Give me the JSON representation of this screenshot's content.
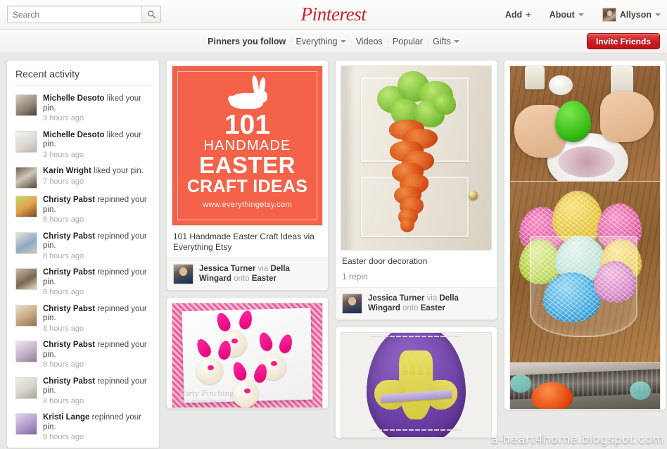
{
  "header": {
    "logo": "Pinterest",
    "search": {
      "placeholder": "Search",
      "value": ""
    },
    "search_icon": "search-icon",
    "add": {
      "label": "Add",
      "plus": "+"
    },
    "about": {
      "label": "About"
    },
    "user": {
      "label": "Allyson"
    }
  },
  "subnav": {
    "pinners_you_follow": "Pinners you follow",
    "sep": "·",
    "everything": "Everything",
    "videos": "Videos",
    "popular": "Popular",
    "gifts": "Gifts",
    "invite": "Invite Friends",
    "invite_color": "#cd1f25"
  },
  "sidebar": {
    "title": "Recent activity",
    "items": [
      {
        "user": "Michelle Desoto",
        "action": "liked your pin.",
        "time": "3 hours ago"
      },
      {
        "user": "Michelle Desoto",
        "action": "liked your pin.",
        "time": "3 hours ago"
      },
      {
        "user": "Karin Wright",
        "action": "liked your pin.",
        "time": "7 hours ago"
      },
      {
        "user": "Christy Pabst",
        "action": "repinned your pin.",
        "time": "8 hours ago"
      },
      {
        "user": "Christy Pabst",
        "action": "repinned your pin.",
        "time": "8 hours ago"
      },
      {
        "user": "Christy Pabst",
        "action": "repinned your pin.",
        "time": "8 hours ago"
      },
      {
        "user": "Christy Pabst",
        "action": "repinned your pin.",
        "time": "8 hours ago"
      },
      {
        "user": "Christy Pabst",
        "action": "repinned your pin.",
        "time": "8 hours ago"
      },
      {
        "user": "Christy Pabst",
        "action": "repinned your pin.",
        "time": "8 hours ago"
      },
      {
        "user": "Kristi Lange",
        "action": "repinned your pin.",
        "time": "9 hours ago"
      }
    ]
  },
  "pins": {
    "col1": [
      {
        "caption": "101 Handmade Easter Craft Ideas via Everything Etsy",
        "repins": "",
        "pinner": "Jessica Turner",
        "via_label": "via",
        "via_user": "Della Wingard",
        "onto_label": "onto",
        "board": "Easter",
        "art": {
          "count": "101",
          "line2": "HANDMADE",
          "line3": "EASTER",
          "line4": "CRAFT IDEAS",
          "url": "www.everythingetsy.com",
          "bg": "#f4624a"
        }
      },
      {
        "caption": "",
        "repins": "",
        "art": {
          "watermark": "Party Pinching",
          "watermark_sub": "www.partypinching.com"
        }
      }
    ],
    "col2": [
      {
        "caption": "Easter door decoration",
        "repins": "1 repin",
        "pinner": "Jessica Turner",
        "via_label": "via",
        "via_user": "Della Wingard",
        "onto_label": "onto",
        "board": "Easter"
      },
      {
        "caption": "",
        "repins": ""
      }
    ],
    "col3": [
      {
        "caption": "",
        "repins": ""
      }
    ]
  },
  "overlay": {
    "watermark": "a-heart4home.blogspot.com"
  }
}
